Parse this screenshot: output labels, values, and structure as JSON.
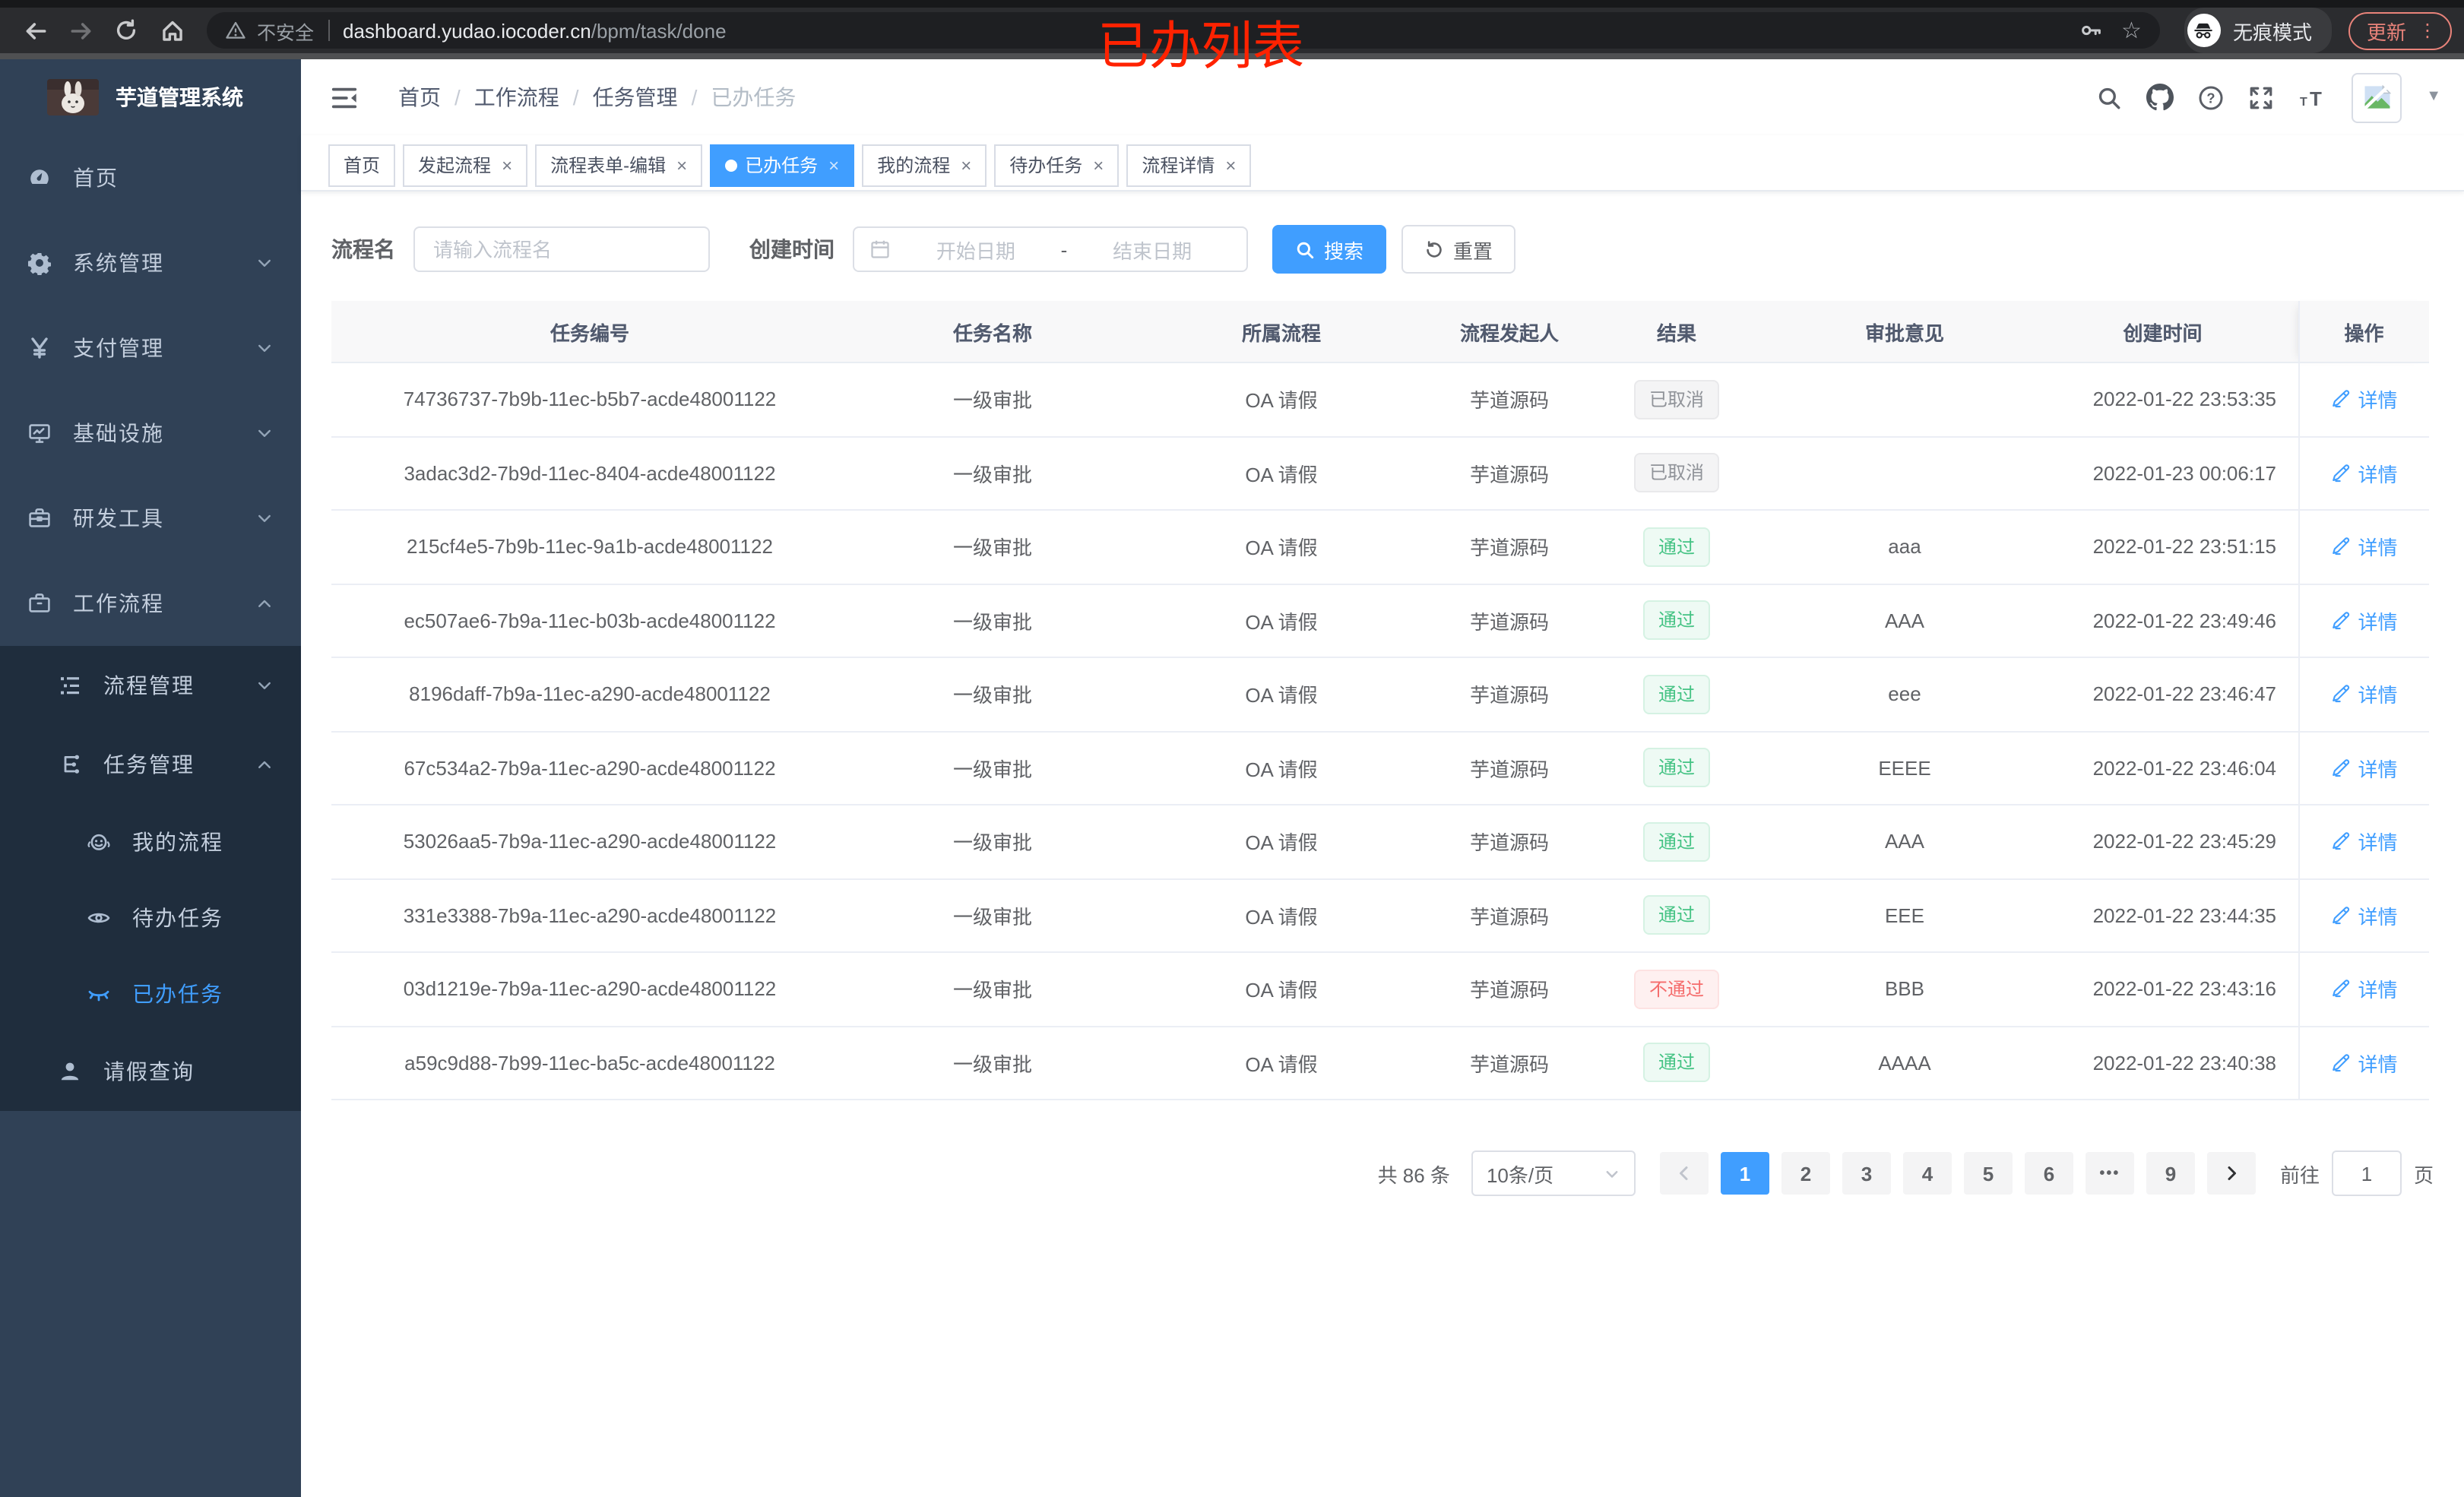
{
  "browser": {
    "security_label": "不安全",
    "url_host": "dashboard.yudao.iocoder.cn",
    "url_path": "/bpm/task/done",
    "incognito_label": "无痕模式",
    "update_label": "更新"
  },
  "annotation_text": "已办列表",
  "sidebar": {
    "logo_title": "芋道管理系统",
    "menu": [
      {
        "label": "首页",
        "icon": "dashboard",
        "level": 1,
        "chevron": "",
        "sub": false,
        "active": false
      },
      {
        "label": "系统管理",
        "icon": "gear",
        "level": 1,
        "chevron": "down",
        "sub": false,
        "active": false
      },
      {
        "label": "支付管理",
        "icon": "yen",
        "level": 1,
        "chevron": "down",
        "sub": false,
        "active": false
      },
      {
        "label": "基础设施",
        "icon": "monitor",
        "level": 1,
        "chevron": "down",
        "sub": false,
        "active": false
      },
      {
        "label": "研发工具",
        "icon": "toolbox",
        "level": 1,
        "chevron": "down",
        "sub": false,
        "active": false
      },
      {
        "label": "工作流程",
        "icon": "briefcase",
        "level": 1,
        "chevron": "up",
        "sub": false,
        "active": false
      },
      {
        "label": "流程管理",
        "icon": "list-tree",
        "level": 2,
        "chevron": "down",
        "sub": true,
        "active": false
      },
      {
        "label": "任务管理",
        "icon": "node-tree",
        "level": 2,
        "chevron": "up",
        "sub": true,
        "active": false
      },
      {
        "label": "我的流程",
        "icon": "face",
        "level": 3,
        "chevron": "",
        "sub": true,
        "active": false
      },
      {
        "label": "待办任务",
        "icon": "eye-open",
        "level": 3,
        "chevron": "",
        "sub": true,
        "active": false
      },
      {
        "label": "已办任务",
        "icon": "eye-closed",
        "level": 3,
        "chevron": "",
        "sub": true,
        "active": true
      },
      {
        "label": "请假查询",
        "icon": "person",
        "level": 2,
        "chevron": "",
        "sub": true,
        "active": false
      }
    ]
  },
  "navbar": {
    "breadcrumb": [
      "首页",
      "工作流程",
      "任务管理",
      "已办任务"
    ]
  },
  "tabs": [
    {
      "label": "首页",
      "closable": false,
      "active": false
    },
    {
      "label": "发起流程",
      "closable": true,
      "active": false
    },
    {
      "label": "流程表单-编辑",
      "closable": true,
      "active": false
    },
    {
      "label": "已办任务",
      "closable": true,
      "active": true
    },
    {
      "label": "我的流程",
      "closable": true,
      "active": false
    },
    {
      "label": "待办任务",
      "closable": true,
      "active": false
    },
    {
      "label": "流程详情",
      "closable": true,
      "active": false
    }
  ],
  "filter": {
    "name_label": "流程名",
    "name_placeholder": "请输入流程名",
    "date_label": "创建时间",
    "date_start_placeholder": "开始日期",
    "date_separator": "-",
    "date_end_placeholder": "结束日期",
    "search_label": "搜索",
    "reset_label": "重置"
  },
  "table": {
    "columns": [
      "任务编号",
      "任务名称",
      "所属流程",
      "流程发起人",
      "结果",
      "审批意见",
      "创建时间",
      "操作"
    ],
    "action_label": "详情",
    "rows": [
      {
        "id": "74736737-7b9b-11ec-b5b7-acde48001122",
        "name": "一级审批",
        "process": "OA 请假",
        "starter": "芋道源码",
        "result": "已取消",
        "result_type": "cancel",
        "comment": "",
        "time": "2022-01-22 23:53:35"
      },
      {
        "id": "3adac3d2-7b9d-11ec-8404-acde48001122",
        "name": "一级审批",
        "process": "OA 请假",
        "starter": "芋道源码",
        "result": "已取消",
        "result_type": "cancel",
        "comment": "",
        "time": "2022-01-23 00:06:17"
      },
      {
        "id": "215cf4e5-7b9b-11ec-9a1b-acde48001122",
        "name": "一级审批",
        "process": "OA 请假",
        "starter": "芋道源码",
        "result": "通过",
        "result_type": "pass",
        "comment": "aaa",
        "time": "2022-01-22 23:51:15"
      },
      {
        "id": "ec507ae6-7b9a-11ec-b03b-acde48001122",
        "name": "一级审批",
        "process": "OA 请假",
        "starter": "芋道源码",
        "result": "通过",
        "result_type": "pass",
        "comment": "AAA",
        "time": "2022-01-22 23:49:46"
      },
      {
        "id": "8196daff-7b9a-11ec-a290-acde48001122",
        "name": "一级审批",
        "process": "OA 请假",
        "starter": "芋道源码",
        "result": "通过",
        "result_type": "pass",
        "comment": "eee",
        "time": "2022-01-22 23:46:47"
      },
      {
        "id": "67c534a2-7b9a-11ec-a290-acde48001122",
        "name": "一级审批",
        "process": "OA 请假",
        "starter": "芋道源码",
        "result": "通过",
        "result_type": "pass",
        "comment": "EEEE",
        "time": "2022-01-22 23:46:04"
      },
      {
        "id": "53026aa5-7b9a-11ec-a290-acde48001122",
        "name": "一级审批",
        "process": "OA 请假",
        "starter": "芋道源码",
        "result": "通过",
        "result_type": "pass",
        "comment": "AAA",
        "time": "2022-01-22 23:45:29"
      },
      {
        "id": "331e3388-7b9a-11ec-a290-acde48001122",
        "name": "一级审批",
        "process": "OA 请假",
        "starter": "芋道源码",
        "result": "通过",
        "result_type": "pass",
        "comment": "EEE",
        "time": "2022-01-22 23:44:35"
      },
      {
        "id": "03d1219e-7b9a-11ec-a290-acde48001122",
        "name": "一级审批",
        "process": "OA 请假",
        "starter": "芋道源码",
        "result": "不通过",
        "result_type": "fail",
        "comment": "BBB",
        "time": "2022-01-22 23:43:16"
      },
      {
        "id": "a59c9d88-7b99-11ec-ba5c-acde48001122",
        "name": "一级审批",
        "process": "OA 请假",
        "starter": "芋道源码",
        "result": "通过",
        "result_type": "pass",
        "comment": "AAAA",
        "time": "2022-01-22 23:40:38"
      }
    ]
  },
  "pagination": {
    "total_label": "共 86 条",
    "page_size_label": "10条/页",
    "pages": [
      "1",
      "2",
      "3",
      "4",
      "5",
      "6",
      "•••",
      "9"
    ],
    "active_page": "1",
    "goto_label": "前往",
    "goto_value": "1",
    "page_unit_label": "页"
  }
}
